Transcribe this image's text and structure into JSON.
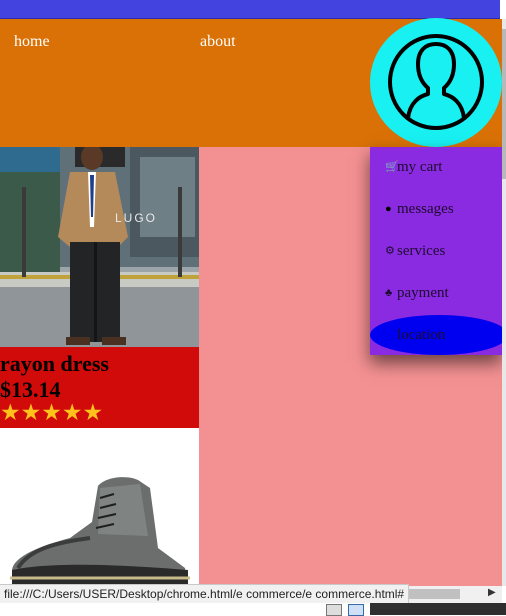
{
  "nav": {
    "home": "home",
    "about": "about"
  },
  "product1": {
    "name": "rayon dress",
    "price": "$13.14",
    "rating_stars": 5,
    "stars": "★★★★★",
    "image_sign": "LUGO"
  },
  "dropdown": {
    "items": [
      {
        "icon": "cart-icon",
        "glyph": "🛒",
        "label": "my cart"
      },
      {
        "icon": "message-dot-icon",
        "glyph": "●",
        "label": "messages"
      },
      {
        "icon": "gear-icon",
        "glyph": "⚙",
        "label": "services"
      },
      {
        "icon": "payment-icon",
        "glyph": "♣",
        "label": "payment"
      },
      {
        "icon": "location-icon",
        "glyph": "",
        "label": "location"
      }
    ]
  },
  "statusbar": {
    "url": "file:///C:/Users/USER/Desktop/chrome.html/e commerce/e commerce.html#"
  },
  "colors": {
    "navbar": "#d97106",
    "avatar": "#18f0f2",
    "dropdown": "#8b2be1",
    "pink": "#f39092",
    "product_info": "#d10a0a",
    "location_highlight": "#0000f0",
    "stars": "#ffc21a"
  }
}
